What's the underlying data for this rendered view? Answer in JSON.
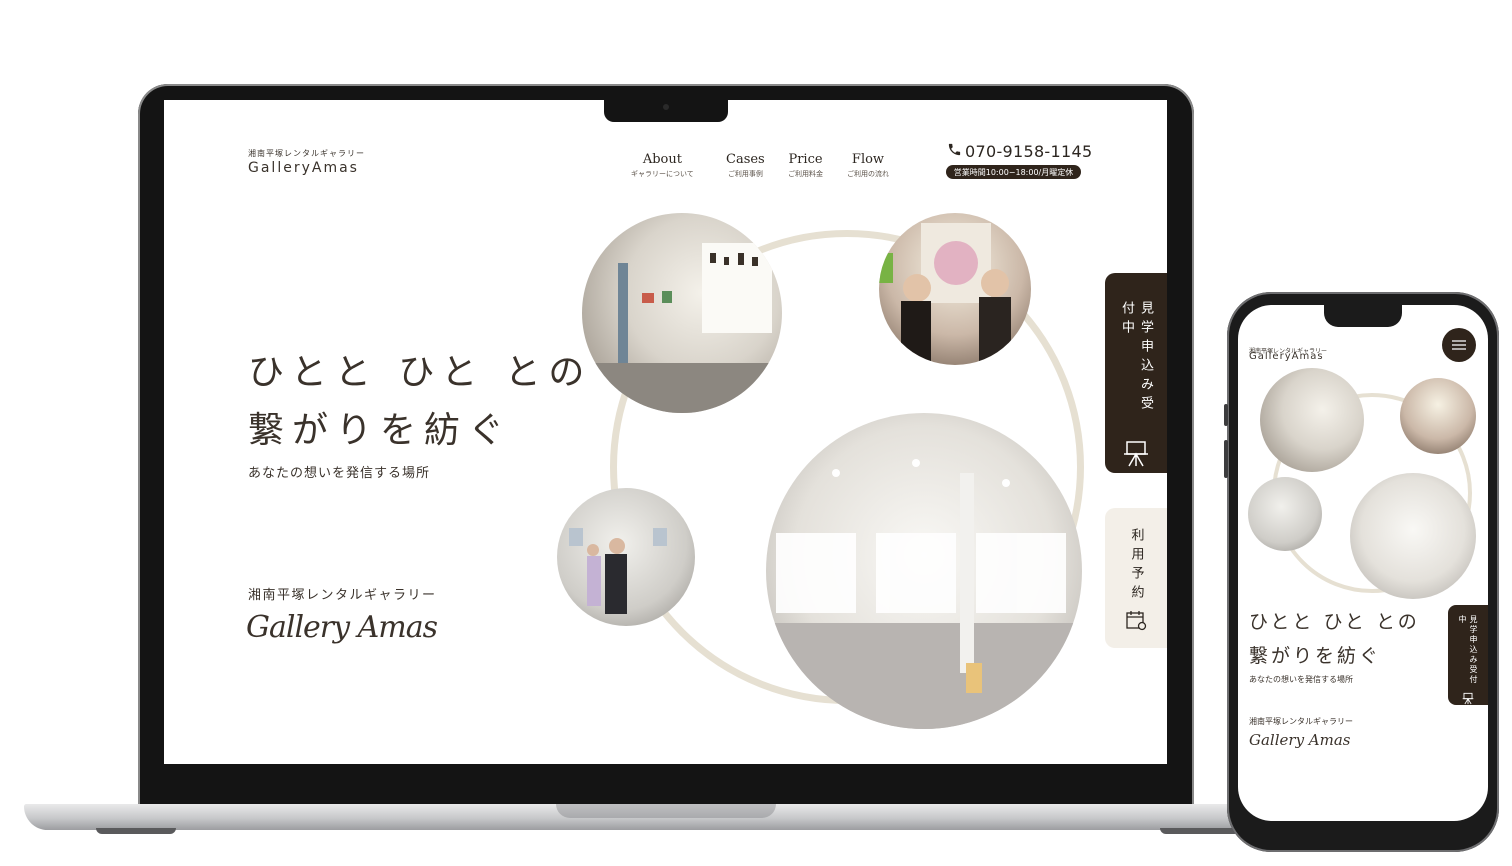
{
  "site": {
    "subtitle": "湘南平塚レンタルギャラリー",
    "logo": "GalleryAmas"
  },
  "nav": [
    {
      "en": "About",
      "jp": "ギャラリーについて"
    },
    {
      "en": "Cases",
      "jp": "ご利用事例"
    },
    {
      "en": "Price",
      "jp": "ご利用料金"
    },
    {
      "en": "Flow",
      "jp": "ご利用の流れ"
    }
  ],
  "contact": {
    "phone": "070-9158-1145",
    "hours": "営業時間10:00−18:00/月曜定休"
  },
  "hero": {
    "title_line1": "ひとと ひと との",
    "title_line2": "繋がりを紡ぐ",
    "subtitle": "あなたの想いを発信する場所",
    "gallery_name_jp": "湘南平塚レンタルギャラリー",
    "script_logo": "Gallery Amas"
  },
  "side_tabs": {
    "visit": "見学申込み受付中",
    "reserve": "利用予約"
  },
  "icons": {
    "phone": "phone-icon",
    "easel": "easel-icon",
    "calendar": "calendar-icon",
    "menu": "hamburger-menu-icon"
  },
  "colors": {
    "brand_dark": "#2f241b",
    "tab_light": "#f3efe8",
    "ring": "#e6e0d2"
  }
}
